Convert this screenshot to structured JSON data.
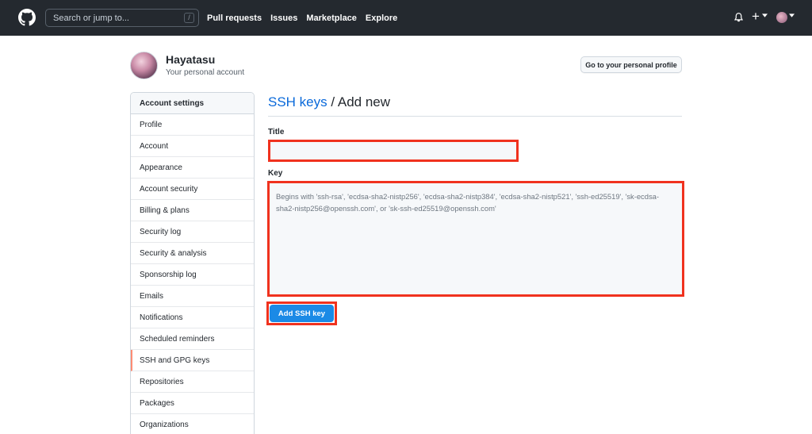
{
  "header": {
    "search_placeholder": "Search or jump to...",
    "search_key": "/",
    "nav": [
      "Pull requests",
      "Issues",
      "Marketplace",
      "Explore"
    ],
    "plus": "+"
  },
  "profile": {
    "name": "Hayatasu",
    "subtitle": "Your personal account",
    "profile_button": "Go to your personal profile"
  },
  "sidebar": {
    "heading": "Account settings",
    "items": [
      {
        "label": "Profile"
      },
      {
        "label": "Account"
      },
      {
        "label": "Appearance"
      },
      {
        "label": "Account security"
      },
      {
        "label": "Billing & plans"
      },
      {
        "label": "Security log"
      },
      {
        "label": "Security & analysis"
      },
      {
        "label": "Sponsorship log"
      },
      {
        "label": "Emails"
      },
      {
        "label": "Notifications"
      },
      {
        "label": "Scheduled reminders"
      },
      {
        "label": "SSH and GPG keys",
        "selected": true
      },
      {
        "label": "Repositories"
      },
      {
        "label": "Packages"
      },
      {
        "label": "Organizations"
      }
    ]
  },
  "main": {
    "heading_link": "SSH keys",
    "heading_rest": " / Add new",
    "title_label": "Title",
    "title_value": "",
    "key_label": "Key",
    "key_placeholder": "Begins with 'ssh-rsa', 'ecdsa-sha2-nistp256', 'ecdsa-sha2-nistp384', 'ecdsa-sha2-nistp521', 'ssh-ed25519', 'sk-ecdsa-sha2-nistp256@openssh.com', or 'sk-ssh-ed25519@openssh.com'",
    "submit_label": "Add SSH key"
  },
  "colors": {
    "header_bg": "#24292f",
    "link": "#0969da",
    "highlight_border": "#f0321e",
    "primary_button": "#1b8ae6",
    "selected_marker": "#fd8c73"
  },
  "icons": [
    "github-logo-icon",
    "bell-icon",
    "plus-icon",
    "caret-down-icon",
    "avatar"
  ]
}
